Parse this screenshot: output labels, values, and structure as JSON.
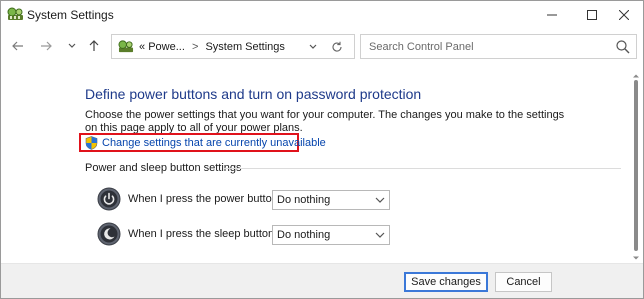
{
  "window": {
    "title": "System Settings"
  },
  "nav": {
    "breadcrumb_prefix": "«",
    "breadcrumb_parent": "Powe...",
    "breadcrumb_separator": ">",
    "breadcrumb_current": "System Settings"
  },
  "search": {
    "placeholder": "Search Control Panel",
    "value": ""
  },
  "content": {
    "heading": "Define power buttons and turn on password protection",
    "description": "Choose the power settings that you want for your computer. The changes you make to the settings on this page apply to all of your power plans.",
    "change_link": "Change settings that are currently unavailable",
    "section_title": "Power and sleep button settings",
    "power_row": {
      "label": "When I press the power button:",
      "value": "Do nothing"
    },
    "sleep_row": {
      "label": "When I press the sleep button:",
      "value": "Do nothing"
    }
  },
  "footer": {
    "save_label": "Save changes",
    "cancel_label": "Cancel"
  },
  "colors": {
    "heading": "#1e3a8a",
    "link": "#0645ad",
    "highlight_box": "#e0121b",
    "primary_button_border": "#3b78d8",
    "footer_bg": "#f0f0f0"
  },
  "icons": {
    "app": "control-panel-icon",
    "back": "back-arrow-icon",
    "forward": "forward-arrow-icon",
    "recent": "chevron-down-icon",
    "up": "up-arrow-icon",
    "refresh": "refresh-icon",
    "search": "search-icon",
    "shield": "uac-shield-icon",
    "power_button": "power-button-icon",
    "sleep_button": "sleep-button-icon"
  }
}
